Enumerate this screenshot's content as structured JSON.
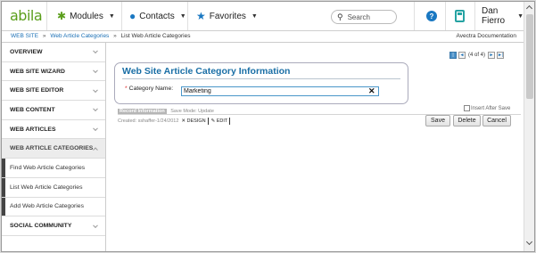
{
  "topnav": {
    "logo": "abila",
    "menus": [
      {
        "label": "Modules",
        "icon": "puzzle-icon"
      },
      {
        "label": "Contacts",
        "icon": "person-icon"
      },
      {
        "label": "Favorites",
        "icon": "star-icon"
      }
    ],
    "search_placeholder": "Search",
    "help_label": "?",
    "user": "Dan Fierro"
  },
  "breadcrumb": {
    "items": [
      "WEB SITE",
      "Web Article Categories",
      "List Web Article Categories"
    ],
    "separator": "»",
    "right_link": "Avectra Documentation"
  },
  "sidebar": {
    "items": [
      {
        "label": "OVERVIEW"
      },
      {
        "label": "WEB SITE WIZARD"
      },
      {
        "label": "WEB SITE EDITOR"
      },
      {
        "label": "WEB CONTENT"
      },
      {
        "label": "WEB ARTICLES"
      },
      {
        "label": "WEB ARTICLE CATEGORIES"
      },
      {
        "label": "Find Web Article Categories"
      },
      {
        "label": "List Web Article Categories"
      },
      {
        "label": "Add Web Article Categories"
      },
      {
        "label": "SOCIAL COMMUNITY"
      }
    ]
  },
  "pager": {
    "first": "|◄",
    "prev": "◄",
    "count": "(4 of 4)",
    "next": "►",
    "last": "►|"
  },
  "form": {
    "title": "Web Site Article Category Information",
    "required_mark": "*",
    "field_label": "Category Name:",
    "field_value": "Marketing",
    "clear_glyph": "✕"
  },
  "record": {
    "tab_label": "Record Information",
    "save_mode": "Save Mode: Update",
    "created": "Created: sshaffer-1/24/2012",
    "design_link": "DESIGN",
    "edit_link": "EDIT",
    "insert_after_save": "Insert After Save"
  },
  "buttons": {
    "save": "Save",
    "delete": "Delete",
    "cancel": "Cancel"
  },
  "colors": {
    "brand_green": "#5a9e1b",
    "link_blue": "#1a6fb5",
    "title_blue": "#1a6fa6",
    "help_blue": "#1a78c2",
    "calc_teal": "#26a3a3",
    "required_red": "#dd2222"
  }
}
